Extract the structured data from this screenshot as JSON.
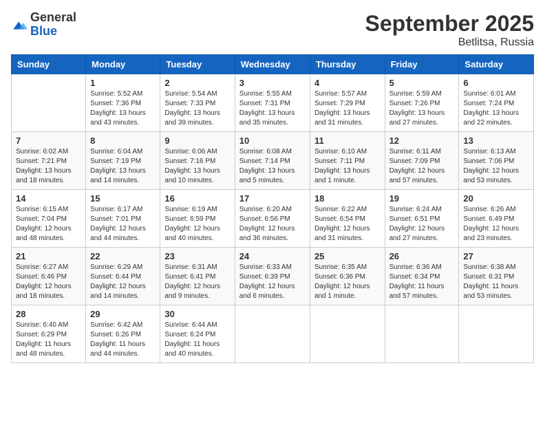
{
  "logo": {
    "general": "General",
    "blue": "Blue"
  },
  "header": {
    "month_year": "September 2025",
    "location": "Betlitsa, Russia"
  },
  "weekdays": [
    "Sunday",
    "Monday",
    "Tuesday",
    "Wednesday",
    "Thursday",
    "Friday",
    "Saturday"
  ],
  "weeks": [
    [
      {
        "day": "",
        "sunrise": "",
        "sunset": "",
        "daylight": ""
      },
      {
        "day": "1",
        "sunrise": "Sunrise: 5:52 AM",
        "sunset": "Sunset: 7:36 PM",
        "daylight": "Daylight: 13 hours and 43 minutes."
      },
      {
        "day": "2",
        "sunrise": "Sunrise: 5:54 AM",
        "sunset": "Sunset: 7:33 PM",
        "daylight": "Daylight: 13 hours and 39 minutes."
      },
      {
        "day": "3",
        "sunrise": "Sunrise: 5:55 AM",
        "sunset": "Sunset: 7:31 PM",
        "daylight": "Daylight: 13 hours and 35 minutes."
      },
      {
        "day": "4",
        "sunrise": "Sunrise: 5:57 AM",
        "sunset": "Sunset: 7:29 PM",
        "daylight": "Daylight: 13 hours and 31 minutes."
      },
      {
        "day": "5",
        "sunrise": "Sunrise: 5:59 AM",
        "sunset": "Sunset: 7:26 PM",
        "daylight": "Daylight: 13 hours and 27 minutes."
      },
      {
        "day": "6",
        "sunrise": "Sunrise: 6:01 AM",
        "sunset": "Sunset: 7:24 PM",
        "daylight": "Daylight: 13 hours and 22 minutes."
      }
    ],
    [
      {
        "day": "7",
        "sunrise": "Sunrise: 6:02 AM",
        "sunset": "Sunset: 7:21 PM",
        "daylight": "Daylight: 13 hours and 18 minutes."
      },
      {
        "day": "8",
        "sunrise": "Sunrise: 6:04 AM",
        "sunset": "Sunset: 7:19 PM",
        "daylight": "Daylight: 13 hours and 14 minutes."
      },
      {
        "day": "9",
        "sunrise": "Sunrise: 6:06 AM",
        "sunset": "Sunset: 7:16 PM",
        "daylight": "Daylight: 13 hours and 10 minutes."
      },
      {
        "day": "10",
        "sunrise": "Sunrise: 6:08 AM",
        "sunset": "Sunset: 7:14 PM",
        "daylight": "Daylight: 13 hours and 5 minutes."
      },
      {
        "day": "11",
        "sunrise": "Sunrise: 6:10 AM",
        "sunset": "Sunset: 7:11 PM",
        "daylight": "Daylight: 13 hours and 1 minute."
      },
      {
        "day": "12",
        "sunrise": "Sunrise: 6:11 AM",
        "sunset": "Sunset: 7:09 PM",
        "daylight": "Daylight: 12 hours and 57 minutes."
      },
      {
        "day": "13",
        "sunrise": "Sunrise: 6:13 AM",
        "sunset": "Sunset: 7:06 PM",
        "daylight": "Daylight: 12 hours and 53 minutes."
      }
    ],
    [
      {
        "day": "14",
        "sunrise": "Sunrise: 6:15 AM",
        "sunset": "Sunset: 7:04 PM",
        "daylight": "Daylight: 12 hours and 48 minutes."
      },
      {
        "day": "15",
        "sunrise": "Sunrise: 6:17 AM",
        "sunset": "Sunset: 7:01 PM",
        "daylight": "Daylight: 12 hours and 44 minutes."
      },
      {
        "day": "16",
        "sunrise": "Sunrise: 6:19 AM",
        "sunset": "Sunset: 6:59 PM",
        "daylight": "Daylight: 12 hours and 40 minutes."
      },
      {
        "day": "17",
        "sunrise": "Sunrise: 6:20 AM",
        "sunset": "Sunset: 6:56 PM",
        "daylight": "Daylight: 12 hours and 36 minutes."
      },
      {
        "day": "18",
        "sunrise": "Sunrise: 6:22 AM",
        "sunset": "Sunset: 6:54 PM",
        "daylight": "Daylight: 12 hours and 31 minutes."
      },
      {
        "day": "19",
        "sunrise": "Sunrise: 6:24 AM",
        "sunset": "Sunset: 6:51 PM",
        "daylight": "Daylight: 12 hours and 27 minutes."
      },
      {
        "day": "20",
        "sunrise": "Sunrise: 6:26 AM",
        "sunset": "Sunset: 6:49 PM",
        "daylight": "Daylight: 12 hours and 23 minutes."
      }
    ],
    [
      {
        "day": "21",
        "sunrise": "Sunrise: 6:27 AM",
        "sunset": "Sunset: 6:46 PM",
        "daylight": "Daylight: 12 hours and 18 minutes."
      },
      {
        "day": "22",
        "sunrise": "Sunrise: 6:29 AM",
        "sunset": "Sunset: 6:44 PM",
        "daylight": "Daylight: 12 hours and 14 minutes."
      },
      {
        "day": "23",
        "sunrise": "Sunrise: 6:31 AM",
        "sunset": "Sunset: 6:41 PM",
        "daylight": "Daylight: 12 hours and 9 minutes."
      },
      {
        "day": "24",
        "sunrise": "Sunrise: 6:33 AM",
        "sunset": "Sunset: 6:39 PM",
        "daylight": "Daylight: 12 hours and 6 minutes."
      },
      {
        "day": "25",
        "sunrise": "Sunrise: 6:35 AM",
        "sunset": "Sunset: 6:36 PM",
        "daylight": "Daylight: 12 hours and 1 minute."
      },
      {
        "day": "26",
        "sunrise": "Sunrise: 6:36 AM",
        "sunset": "Sunset: 6:34 PM",
        "daylight": "Daylight: 11 hours and 57 minutes."
      },
      {
        "day": "27",
        "sunrise": "Sunrise: 6:38 AM",
        "sunset": "Sunset: 6:31 PM",
        "daylight": "Daylight: 11 hours and 53 minutes."
      }
    ],
    [
      {
        "day": "28",
        "sunrise": "Sunrise: 6:40 AM",
        "sunset": "Sunset: 6:29 PM",
        "daylight": "Daylight: 11 hours and 48 minutes."
      },
      {
        "day": "29",
        "sunrise": "Sunrise: 6:42 AM",
        "sunset": "Sunset: 6:26 PM",
        "daylight": "Daylight: 11 hours and 44 minutes."
      },
      {
        "day": "30",
        "sunrise": "Sunrise: 6:44 AM",
        "sunset": "Sunset: 6:24 PM",
        "daylight": "Daylight: 11 hours and 40 minutes."
      },
      {
        "day": "",
        "sunrise": "",
        "sunset": "",
        "daylight": ""
      },
      {
        "day": "",
        "sunrise": "",
        "sunset": "",
        "daylight": ""
      },
      {
        "day": "",
        "sunrise": "",
        "sunset": "",
        "daylight": ""
      },
      {
        "day": "",
        "sunrise": "",
        "sunset": "",
        "daylight": ""
      }
    ]
  ]
}
